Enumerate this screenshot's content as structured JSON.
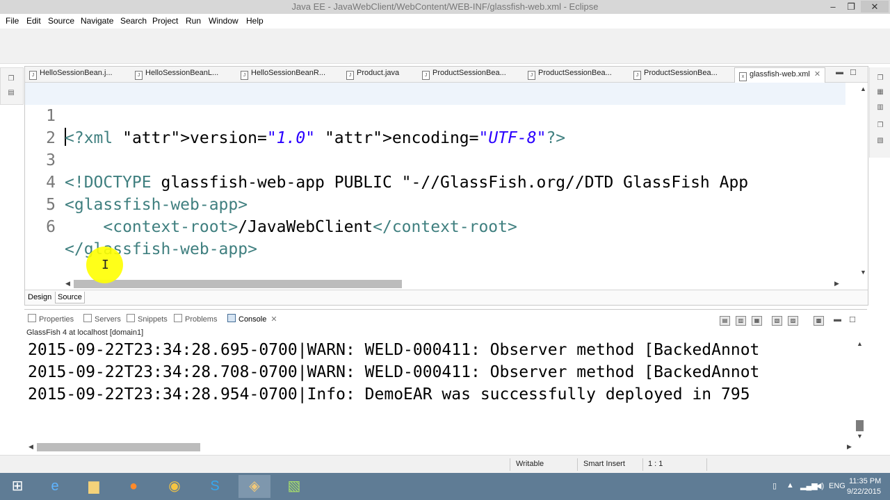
{
  "window": {
    "title": "Java EE - JavaWebClient/WebContent/WEB-INF/glassfish-web.xml - Eclipse",
    "minimize": "–",
    "restore": "❐",
    "close": "✕"
  },
  "menu": [
    "File",
    "Edit",
    "Source",
    "Navigate",
    "Search",
    "Project",
    "Run",
    "Window",
    "Help"
  ],
  "editor_tabs": [
    {
      "label": "HelloSessionBean.j..."
    },
    {
      "label": "HelloSessionBeanL..."
    },
    {
      "label": "HelloSessionBeanR..."
    },
    {
      "label": "Product.java"
    },
    {
      "label": "ProductSessionBea..."
    },
    {
      "label": "ProductSessionBea..."
    },
    {
      "label": "ProductSessionBea..."
    },
    {
      "label": "glassfish-web.xml",
      "active": true
    }
  ],
  "code_lines": [
    {
      "num": "1",
      "text": "<?xml version=\"1.0\" encoding=\"UTF-8\"?>"
    },
    {
      "num": "2",
      "text": ""
    },
    {
      "num": "3",
      "text": "<!DOCTYPE glassfish-web-app PUBLIC \"-//GlassFish.org//DTD GlassFish App"
    },
    {
      "num": "4",
      "text": "<glassfish-web-app>"
    },
    {
      "num": "5",
      "text": "    <context-root>/JavaWebClient</context-root>"
    },
    {
      "num": "6",
      "text": "</glassfish-web-app>"
    }
  ],
  "editor_bottom_tabs": {
    "design": "Design",
    "source": "Source"
  },
  "console_tabs": [
    {
      "label": "Properties"
    },
    {
      "label": "Servers"
    },
    {
      "label": "Snippets"
    },
    {
      "label": "Problems"
    },
    {
      "label": "Console",
      "active": true
    }
  ],
  "console": {
    "label": "GlassFish 4 at localhost [domain1]",
    "lines": [
      "2015-09-22T23:34:28.695-0700|WARN: WELD-000411: Observer method [BackedAnnot",
      "2015-09-22T23:34:28.708-0700|WARN: WELD-000411: Observer method [BackedAnnot",
      "2015-09-22T23:34:28.954-0700|Info: DemoEAR was successfully deployed in 795"
    ]
  },
  "status": {
    "writable": "Writable",
    "insert_mode": "Smart Insert",
    "position": "1 : 1"
  },
  "taskbar": {
    "language": "ENG",
    "time": "11:35 PM",
    "date": "9/22/2015",
    "apps": [
      "start-icon",
      "ie-icon",
      "explorer-icon",
      "firefox-icon",
      "chrome-icon",
      "skype-icon",
      "eclipse-icon",
      "editor-icon"
    ]
  }
}
